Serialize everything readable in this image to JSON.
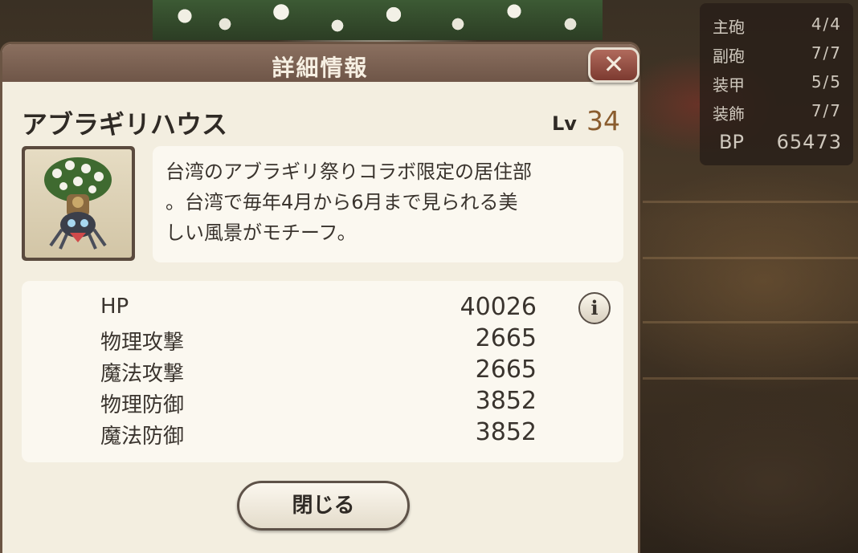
{
  "stats_panel": {
    "rows": [
      {
        "label": "主砲",
        "value": "4/4"
      },
      {
        "label": "副砲",
        "value": "7/7"
      },
      {
        "label": "装甲",
        "value": "5/5"
      },
      {
        "label": "装飾",
        "value": "7/7"
      }
    ],
    "bp": {
      "label": "BP",
      "value": "65473"
    }
  },
  "dialog": {
    "title": "詳細情報",
    "close_icon": "close-x-icon",
    "item_name": "アブラギリハウス",
    "level_label": "Lv",
    "level_value": "34",
    "description": "台湾のアブラギリ祭りコラボ限定の居住部\n。台湾で毎年4月から6月まで見られる美\nしい風景がモチーフ。",
    "stats": [
      {
        "label": "HP",
        "value": "40026"
      },
      {
        "label": "物理攻撃",
        "value": "2665"
      },
      {
        "label": "魔法攻撃",
        "value": "2665"
      },
      {
        "label": "物理防御",
        "value": "3852"
      },
      {
        "label": "魔法防御",
        "value": "3852"
      }
    ],
    "info_icon_text": "i",
    "close_button_label": "閉じる"
  }
}
